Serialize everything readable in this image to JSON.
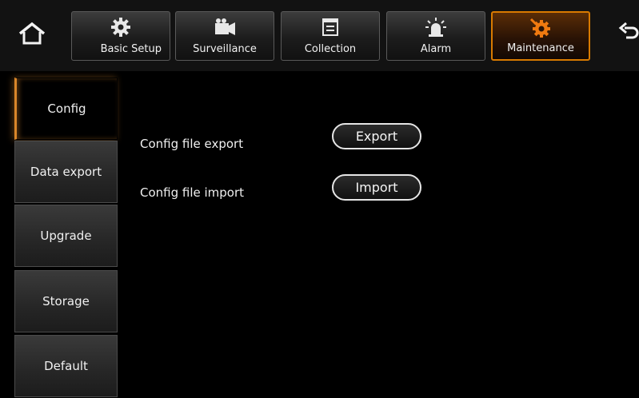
{
  "topbar": {
    "home_icon": "home-icon",
    "back_icon": "back-arrow-icon",
    "tabs": [
      {
        "label": "Basic Setup",
        "icon": "gear-icon",
        "active": false
      },
      {
        "label": "Surveillance",
        "icon": "camera-icon",
        "active": false
      },
      {
        "label": "Collection",
        "icon": "document-icon",
        "active": false
      },
      {
        "label": "Alarm",
        "icon": "alarm-light-icon",
        "active": false
      },
      {
        "label": "Maintenance",
        "icon": "maintenance-gear-icon",
        "active": true
      }
    ]
  },
  "sidebar": {
    "items": [
      {
        "label": "Config",
        "active": true
      },
      {
        "label": "Data export",
        "active": false
      },
      {
        "label": "Upgrade",
        "active": false
      },
      {
        "label": "Storage",
        "active": false
      },
      {
        "label": "Default",
        "active": false
      }
    ]
  },
  "config": {
    "export_row": {
      "label": "Config file export",
      "button": "Export"
    },
    "import_row": {
      "label": "Config file import",
      "button": "Import"
    }
  },
  "colors": {
    "accent": "#d97a00",
    "background": "#000000",
    "text": "#f0f0f0"
  }
}
